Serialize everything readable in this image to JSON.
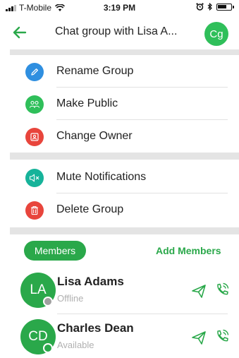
{
  "status_bar": {
    "carrier": "T-Mobile",
    "time": "3:19 PM"
  },
  "header": {
    "title": "Chat group with Lisa A...",
    "avatar_initials": "Cg"
  },
  "menu": {
    "rename_group": "Rename Group",
    "make_public": "Make Public",
    "change_owner": "Change Owner",
    "mute_notifications": "Mute Notifications",
    "delete_group": "Delete Group"
  },
  "members_section": {
    "members_label": "Members",
    "add_members_label": "Add Members"
  },
  "members": [
    {
      "initials": "LA",
      "name": "Lisa Adams",
      "status": "Offline",
      "status_color": "#a0a0a0"
    },
    {
      "initials": "CD",
      "name": "Charles Dean",
      "status": "Available",
      "status_color": "#2aa84a"
    }
  ],
  "colors": {
    "accent": "#2aa84a",
    "rename_icon_bg": "#2f8fe0",
    "public_icon_bg": "#2fbf5a",
    "owner_icon_bg": "#e8453c",
    "mute_icon_bg": "#16b39a",
    "delete_icon_bg": "#e8453c"
  },
  "icons": {
    "back": "arrow-left-icon",
    "rename": "pencil-icon",
    "public": "group-people-icon",
    "owner": "owner-badge-icon",
    "mute": "speaker-mute-icon",
    "delete": "trash-icon",
    "send": "send-paper-plane-icon",
    "call": "phone-call-icon"
  }
}
